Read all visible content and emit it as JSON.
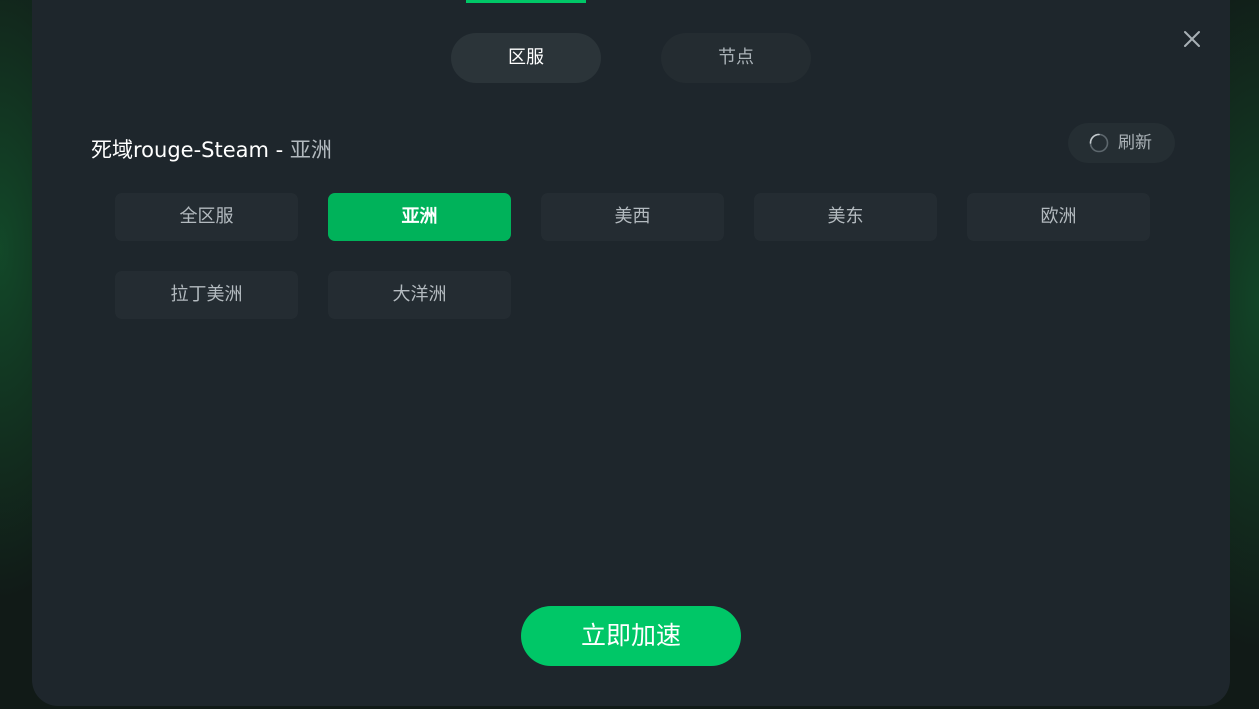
{
  "tabs": {
    "server_region": "区服",
    "nodes": "节点"
  },
  "header": {
    "game_name": "死域rouge-Steam",
    "separator": " - ",
    "selected_region": "亚洲"
  },
  "refresh": {
    "label": "刷新"
  },
  "regions": [
    {
      "label": "全区服",
      "selected": false
    },
    {
      "label": "亚洲",
      "selected": true
    },
    {
      "label": "美西",
      "selected": false
    },
    {
      "label": "美东",
      "selected": false
    },
    {
      "label": "欧洲",
      "selected": false
    },
    {
      "label": "拉丁美洲",
      "selected": false
    },
    {
      "label": "大洋洲",
      "selected": false
    }
  ],
  "actions": {
    "accelerate_label": "立即加速"
  },
  "icons": {
    "close": "close-icon",
    "refresh": "loading-spinner-icon"
  },
  "colors": {
    "accent_green": "#00c767",
    "selected_green": "#00b25a",
    "panel_bg": "#1e262c"
  }
}
